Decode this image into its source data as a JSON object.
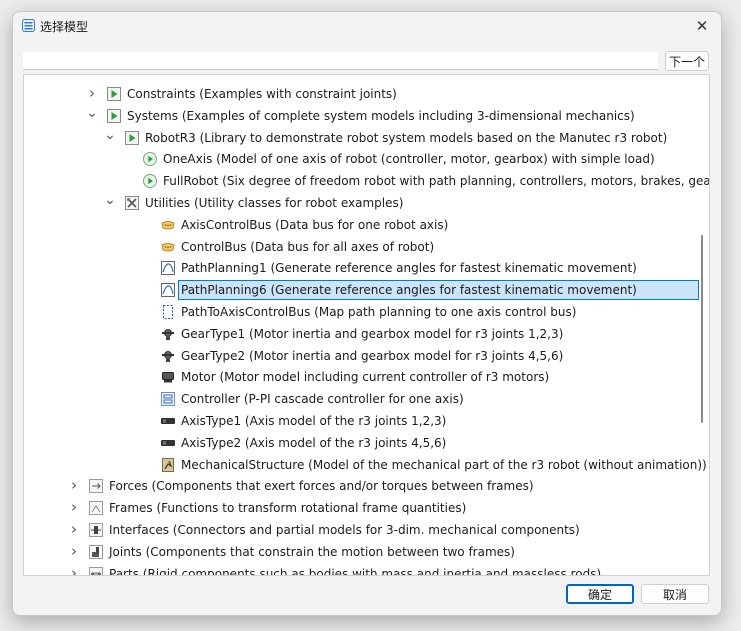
{
  "window": {
    "title": "选择模型",
    "close_symbol": "✕"
  },
  "search": {
    "value": "",
    "placeholder": "",
    "next_label": "下一个"
  },
  "buttons": {
    "ok_label": "确定",
    "cancel_label": "取消"
  },
  "tree": {
    "rows": [
      {
        "label": "Constraints (Examples with constraint joints)",
        "expander": "collapsed",
        "icon": "play-package-icon"
      },
      {
        "label": "Systems (Examples of complete system models including 3-dimensional mechanics)",
        "expander": "expanded",
        "icon": "play-package-icon"
      },
      {
        "label": "RobotR3 (Library to demonstrate robot system models based on the Manutec r3 robot)",
        "expander": "expanded",
        "icon": "play-package-icon"
      },
      {
        "label": "OneAxis (Model of one axis of robot (controller, motor, gearbox) with simple load)",
        "expander": "none",
        "icon": "play-circle-icon"
      },
      {
        "label": "FullRobot (Six degree of freedom robot with path planning, controllers, motors, brakes, gea…",
        "expander": "none",
        "icon": "play-circle-icon"
      },
      {
        "label": "Utilities (Utility classes for robot examples)",
        "expander": "expanded",
        "icon": "tools-icon"
      },
      {
        "label": "AxisControlBus (Data bus for one robot axis)",
        "expander": "none",
        "icon": "bus-icon"
      },
      {
        "label": "ControlBus (Data bus for all axes of robot)",
        "expander": "none",
        "icon": "bus-icon"
      },
      {
        "label": "PathPlanning1 (Generate reference angles for fastest kinematic movement)",
        "expander": "none",
        "icon": "path-planning-icon"
      },
      {
        "label": "PathPlanning6 (Generate reference angles for fastest kinematic movement)",
        "expander": "none",
        "icon": "path-planning-icon",
        "selected": true
      },
      {
        "label": "PathToAxisControlBus (Map path planning to one axis control bus)",
        "expander": "none",
        "icon": "path-to-bus-icon"
      },
      {
        "label": "GearType1 (Motor inertia and gearbox model for r3 joints 1,2,3)",
        "expander": "none",
        "icon": "gear-type-icon"
      },
      {
        "label": "GearType2 (Motor inertia and gearbox model for r3 joints 4,5,6)",
        "expander": "none",
        "icon": "gear-type-icon"
      },
      {
        "label": "Motor (Motor model including current controller of r3 motors)",
        "expander": "none",
        "icon": "motor-icon"
      },
      {
        "label": "Controller (P-PI cascade controller for one axis)",
        "expander": "none",
        "icon": "controller-icon"
      },
      {
        "label": "AxisType1 (Axis model of the r3 joints 1,2,3)",
        "expander": "none",
        "icon": "axis-type-icon"
      },
      {
        "label": "AxisType2 (Axis model of the r3 joints 4,5,6)",
        "expander": "none",
        "icon": "axis-type-icon"
      },
      {
        "label": "MechanicalStructure (Model of the mechanical part of the r3 robot (without animation))",
        "expander": "none",
        "icon": "mechanical-structure-icon"
      },
      {
        "label": "Forces (Components that exert forces and/or torques between frames)",
        "expander": "collapsed",
        "icon": "forces-icon"
      },
      {
        "label": "Frames (Functions to transform rotational frame quantities)",
        "expander": "collapsed",
        "icon": "frames-icon"
      },
      {
        "label": "Interfaces (Connectors and partial models for 3-dim. mechanical components)",
        "expander": "collapsed",
        "icon": "interfaces-icon"
      },
      {
        "label": "Joints (Components that constrain the motion between two frames)",
        "expander": "collapsed",
        "icon": "joints-icon"
      },
      {
        "label": "Parts (Rigid components such as bodies with mass and inertia and massless rods)",
        "expander": "collapsed",
        "icon": "parts-icon"
      }
    ]
  }
}
